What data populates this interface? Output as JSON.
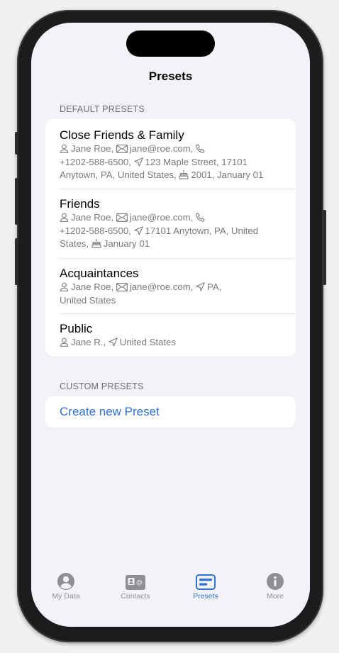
{
  "nav": {
    "title": "Presets"
  },
  "default_section": {
    "header": "DEFAULT PRESETS",
    "presets": [
      {
        "title": "Close Friends & Family",
        "lines": [
          [
            {
              "icon": "person-icon",
              "text": "Jane Roe,"
            },
            {
              "icon": "envelope-icon",
              "text": "jane@roe.com,"
            },
            {
              "icon": "phone-icon",
              "text": ""
            }
          ],
          [
            {
              "icon": null,
              "text": "+1202-588-6500,"
            },
            {
              "icon": "location-arrow-icon",
              "text": "123 Maple Street, 17101"
            }
          ],
          [
            {
              "icon": null,
              "text": "Anytown, PA, United States,"
            },
            {
              "icon": "birthday-cake-icon",
              "text": "2001, January 01"
            }
          ]
        ]
      },
      {
        "title": "Friends",
        "lines": [
          [
            {
              "icon": "person-icon",
              "text": "Jane Roe,"
            },
            {
              "icon": "envelope-icon",
              "text": "jane@roe.com,"
            },
            {
              "icon": "phone-icon",
              "text": ""
            }
          ],
          [
            {
              "icon": null,
              "text": "+1202-588-6500,"
            },
            {
              "icon": "location-arrow-icon",
              "text": "17101 Anytown, PA, United"
            }
          ],
          [
            {
              "icon": null,
              "text": "States,"
            },
            {
              "icon": "birthday-cake-icon",
              "text": "January 01"
            }
          ]
        ]
      },
      {
        "title": "Acquaintances",
        "lines": [
          [
            {
              "icon": "person-icon",
              "text": "Jane Roe,"
            },
            {
              "icon": "envelope-icon",
              "text": "jane@roe.com,"
            },
            {
              "icon": "location-arrow-icon",
              "text": "PA,"
            }
          ],
          [
            {
              "icon": null,
              "text": "United States"
            }
          ]
        ]
      },
      {
        "title": "Public",
        "lines": [
          [
            {
              "icon": "person-icon",
              "text": "Jane R.,"
            },
            {
              "icon": "location-arrow-icon",
              "text": "United States"
            }
          ]
        ]
      }
    ]
  },
  "custom_section": {
    "header": "CUSTOM PRESETS",
    "create_label": "Create new Preset"
  },
  "tabbar": {
    "tabs": [
      {
        "label": "My Data",
        "icon": "person-circle-icon",
        "active": false
      },
      {
        "label": "Contacts",
        "icon": "contact-card-icon",
        "active": false
      },
      {
        "label": "Presets",
        "icon": "presets-card-icon",
        "active": true
      },
      {
        "label": "More",
        "icon": "info-circle-icon",
        "active": false
      }
    ]
  },
  "colors": {
    "accent": "#2f72d6",
    "background": "#f2f2f7",
    "secondary_text": "#7a7a7f",
    "tab_inactive": "#8e8e93"
  }
}
